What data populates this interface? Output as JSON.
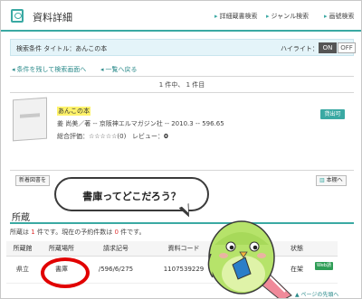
{
  "header": {
    "title": "資料詳細",
    "nav": [
      "詳細蔵書検索",
      "ジャンル検索",
      "画號検索"
    ]
  },
  "search_condition": {
    "label": "検索条件 タイトル：あんこの本",
    "highlight_label": "ハイライト：",
    "on": "ON",
    "off": "OFF"
  },
  "links": {
    "back_keep": "条件を残して検索画面へ",
    "back_list": "一覧へ戻る"
  },
  "result_count": "1 件中、 1 件目",
  "book": {
    "title": "あんこの本",
    "meta": "姜 尚美／著 -- 京阪神エルマガジン社 -- 2010.3 -- 596.65",
    "rating_label": "総合評価：",
    "stars": "☆☆☆☆☆",
    "rating_count": "(0)",
    "review_label": "レビュー：",
    "review_count": "0",
    "loan_button": "貸出可"
  },
  "buttons": {
    "new_books": "新着図書を",
    "bookshelf": "本棚へ"
  },
  "bubble_text": "書庫ってどこだろう？",
  "holdings_section": {
    "title": "所蔵",
    "summary_pre": "所蔵は ",
    "summary_num": "1",
    "summary_mid": " 件です。現在の予約件数は ",
    "summary_num2": "0",
    "summary_post": " 件です。",
    "columns": [
      "所蔵館",
      "所蔵場所",
      "請求記号",
      "資料コード",
      "区分",
      "状態"
    ],
    "rows": [
      {
        "library": "県立",
        "location": "書庫",
        "call_number": "/596/6/275",
        "code": "1107539229",
        "category": "",
        "status": "在架",
        "action": "Web請求"
      }
    ]
  },
  "more_link": "▲ ページの先頭へ"
}
